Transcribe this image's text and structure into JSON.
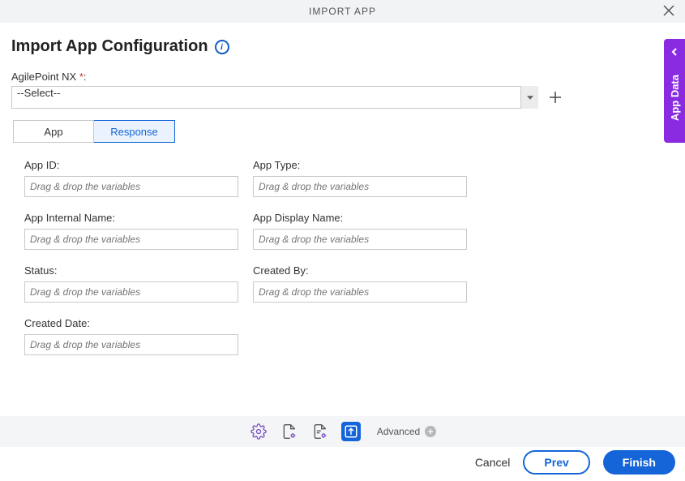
{
  "header": {
    "title": "IMPORT APP"
  },
  "page": {
    "title": "Import App Configuration"
  },
  "agilepoint": {
    "label": "AgilePoint NX ",
    "required_marker": "*",
    "colon": ":",
    "selected": "--Select--"
  },
  "tabs": {
    "app": "App",
    "response": "Response",
    "active": "response"
  },
  "form": {
    "placeholder": "Drag & drop the variables",
    "fields": {
      "app_id": {
        "label": "App ID:"
      },
      "app_type": {
        "label": "App Type:"
      },
      "app_internal": {
        "label": "App Internal Name:"
      },
      "app_display": {
        "label": "App Display Name:"
      },
      "status": {
        "label": "Status:"
      },
      "created_by": {
        "label": "Created By:"
      },
      "created_date": {
        "label": "Created Date:"
      }
    }
  },
  "side_tab": {
    "label": "App Data"
  },
  "footer": {
    "advanced": "Advanced"
  },
  "actions": {
    "cancel": "Cancel",
    "prev": "Prev",
    "finish": "Finish"
  }
}
